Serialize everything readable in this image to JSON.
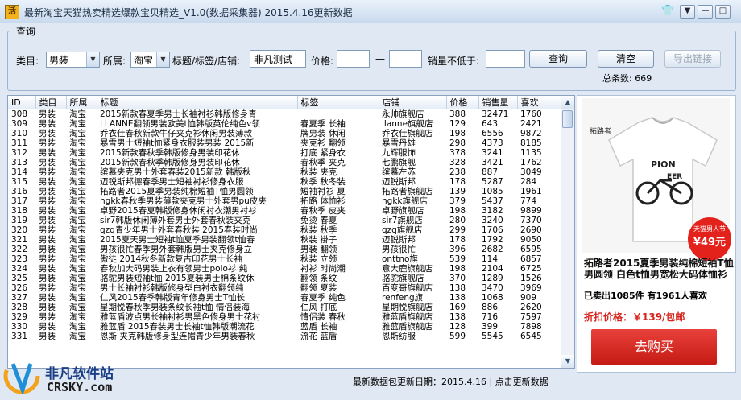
{
  "window": {
    "title": "最新淘宝天猫热卖精选爆款宝贝精选_V1.0(数据采集器)  2015.4.16更新数据",
    "icon_label": "活"
  },
  "query": {
    "legend": "查询",
    "category_label": "类目:",
    "category_value": "男装",
    "belong_label": "所属:",
    "belong_value": "淘宝",
    "keyword_label": "标题/标签/店铺:",
    "keyword_value": "非凡测试",
    "price_label": "价格:",
    "price_min": "",
    "price_sep": "—",
    "price_max": "",
    "min_sales_label": "销量不低于:",
    "min_sales_value": "",
    "query_button": "查询",
    "clear_button": "清空",
    "export_button": "导出链接",
    "total_label": "总条数:",
    "total_value": "669"
  },
  "grid": {
    "columns": [
      "ID",
      "类目",
      "所属",
      "标题",
      "标签",
      "店铺",
      "价格",
      "销售量",
      "喜欢"
    ],
    "rows": [
      [
        "308",
        "男装",
        "淘宝",
        "2015新款春夏季男士长袖衬衫韩版修身青",
        "",
        "永帅旗舰店",
        "388",
        "32471",
        "1760"
      ],
      [
        "309",
        "男装",
        "淘宝",
        "LLANNE翻领男装欧美t恤韩版英伦纯色v领",
        "春夏季 长袖",
        "llanne旗舰店",
        "129",
        "643",
        "2421"
      ],
      [
        "310",
        "男装",
        "淘宝",
        "乔衣仕春秋新款牛仔夹克衫休闲男装薄款",
        "牌男装 休闲",
        "乔衣仕旗舰店",
        "198",
        "6556",
        "9872"
      ],
      [
        "311",
        "男装",
        "淘宝",
        "暴雪男士短袖t恤紧身衣服装男装 2015新",
        "夹克衫 翻领",
        "暴雪丹雄",
        "298",
        "4373",
        "8185"
      ],
      [
        "312",
        "男装",
        "淘宝",
        "2015新款春秋季韩版修身男装印花休",
        "打底 紧身衣",
        "九辉服饰",
        "378",
        "3241",
        "1135"
      ],
      [
        "313",
        "男装",
        "淘宝",
        "2015新款春秋季韩版修身男装印花休",
        "春秋季 夹克",
        "七鹏旗舰",
        "328",
        "3421",
        "1762"
      ],
      [
        "314",
        "男装",
        "淘宝",
        "缤慕夹克男士外套春装2015新款 韩版秋",
        "秋装 夹克",
        "缤慕左苏",
        "238",
        "887",
        "3049"
      ],
      [
        "315",
        "男装",
        "淘宝",
        "迈锐斯邦德春季男士短袖衬衫修身衣服",
        "秋季 秋冬装",
        "迈锐斯邦",
        "178",
        "5287",
        "284"
      ],
      [
        "316",
        "男装",
        "淘宝",
        "拓路者2015夏季男装纯棉短袖T恤男圆领",
        "短袖衬衫 夏",
        "拓路者旗舰店",
        "139",
        "1085",
        "1961"
      ],
      [
        "317",
        "男装",
        "淘宝",
        "ngkk春秋季男装薄款夹克男士外套男pu皮夹",
        "拓路 体恤衫",
        "ngkk旗舰店",
        "379",
        "5437",
        "774"
      ],
      [
        "318",
        "男装",
        "淘宝",
        "卓野2015春夏韩版修身休闲衬衣潮男衬衫",
        "春秋季 皮夹",
        "卓野旗舰店",
        "198",
        "3182",
        "9899"
      ],
      [
        "319",
        "男装",
        "淘宝",
        "sir7韩版休闲薄外套男士外套春秋装夹克",
        "免烫 春夏",
        "sir7旗舰店",
        "280",
        "3240",
        "7370"
      ],
      [
        "320",
        "男装",
        "淘宝",
        "qzq青少年男士外套春秋装 2015春装时尚",
        "秋装 秋季",
        "qzq旗舰店",
        "299",
        "1706",
        "2690"
      ],
      [
        "321",
        "男装",
        "淘宝",
        "2015夏天男士短袖t恤夏季男装翻领t恤春",
        "秋装 褂子",
        "迈锐斯邦",
        "178",
        "1792",
        "9050"
      ],
      [
        "322",
        "男装",
        "淘宝",
        "男孩很忙春季男外套韩版男士夹克修身立",
        "男装 翻领",
        "男孩很忙",
        "396",
        "2682",
        "6595"
      ],
      [
        "323",
        "男装",
        "淘宝",
        "傲徒 2014秋冬新款复古印花男士长袖",
        "秋装 立领",
        "onttno旗",
        "539",
        "114",
        "6857"
      ],
      [
        "324",
        "男装",
        "淘宝",
        "春秋加大码男装上衣有领男士polo衫 纯",
        "衬衫 时尚潮",
        "意大鹿旗舰店",
        "198",
        "2104",
        "6725"
      ],
      [
        "325",
        "男装",
        "淘宝",
        "骆驼男装短袖t恤 2015夏装男士棉条纹休",
        "翻领 条纹",
        "骆驼旗舰店",
        "370",
        "1289",
        "1526"
      ],
      [
        "326",
        "男装",
        "淘宝",
        "男士长袖衬衫韩版修身型白衬衣翻领纯",
        "翻领 夏装",
        "百变哥旗舰店",
        "138",
        "3470",
        "3969"
      ],
      [
        "327",
        "男装",
        "淘宝",
        "仁风2015春季韩版青年修身男士T恤长",
        "春夏季 纯色",
        "renfeng旗",
        "138",
        "1068",
        "909"
      ],
      [
        "328",
        "男装",
        "淘宝",
        "星期悦春秋季男装条纹长袖t恤 情侣装海",
        "仁风 打底",
        "星期悦旗舰店",
        "169",
        "886",
        "2620"
      ],
      [
        "329",
        "男装",
        "淘宝",
        "雅蓝盾波点男长袖衬衫男黑色修身男士花衬",
        "情侣装 春秋",
        "雅蓝盾旗舰店",
        "138",
        "716",
        "7597"
      ],
      [
        "330",
        "男装",
        "淘宝",
        "雅蓝盾 2015春装男士长袖t恤韩版潮流花",
        "蓝盾 长袖",
        "雅蓝盾旗舰店",
        "128",
        "399",
        "7898"
      ],
      [
        "331",
        "男装",
        "淘宝",
        "恩斯 夹克韩版修身型连帽青少年男装春秋",
        "流花 蓝盾",
        "恩斯纺服",
        "599",
        "5545",
        "6545"
      ]
    ]
  },
  "product": {
    "brand_text": "拓路者",
    "badge_top": "天猫男人节",
    "badge_price": "¥49元",
    "title": "拓路者2015夏季男装纯棉短袖T恤男圆领 白色t恤男宽松大码体恤衫",
    "sales_text": "已卖出1085件  有1961人喜欢",
    "discount_text": "折扣价格：￥139/包邮",
    "buy_button": "去购买"
  },
  "footer": {
    "text": "最新数据包更新日期：2015.4.16 | 点击更新数据"
  },
  "watermark": {
    "cn": "非凡软件站",
    "en": "CRSKY.com"
  }
}
